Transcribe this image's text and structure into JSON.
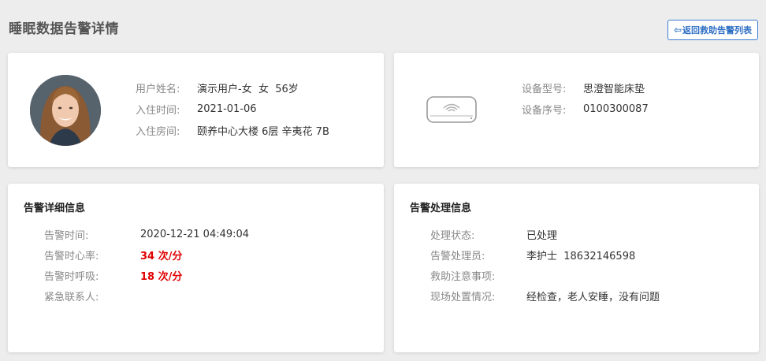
{
  "page": {
    "title": "睡眠数据告警详情"
  },
  "toolbar": {
    "back_label": "返回救助告警列表",
    "back_icon": "arrow-left-icon"
  },
  "user": {
    "name_label": "用户姓名:",
    "name_value": "演示用户-女  女  56岁",
    "checkin_label": "入住时间:",
    "checkin_value": "2021-01-06",
    "room_label": "入住房间:",
    "room_value": "颐养中心大楼 6层 辛夷花 7B"
  },
  "device": {
    "model_label": "设备型号:",
    "model_value": "思澄智能床垫",
    "serial_label": "设备序号:",
    "serial_value": "0100300087",
    "icon": "sleep-monitor-device-icon"
  },
  "alarm": {
    "title": "告警详细信息",
    "time_label": "告警时间:",
    "time_value": "2020-12-21 04:49:04",
    "heart_label": "告警时心率:",
    "heart_value": "34 次/分",
    "breath_label": "告警时呼吸:",
    "breath_value": "18 次/分",
    "contact_label": "紧急联系人:",
    "contact_value": ""
  },
  "process": {
    "title": "告警处理信息",
    "status_label": "处理状态:",
    "status_value": "已处理",
    "handler_label": "告警处理员:",
    "handler_value": "李护士  18632146598",
    "notes_label": "救助注意事项:",
    "notes_value": "",
    "scene_label": "现场处置情况:",
    "scene_value": "经检查，老人安睡，没有问题"
  },
  "colors": {
    "accent": "#2f6fc4",
    "alert": "#e00000",
    "background": "#ededed"
  }
}
